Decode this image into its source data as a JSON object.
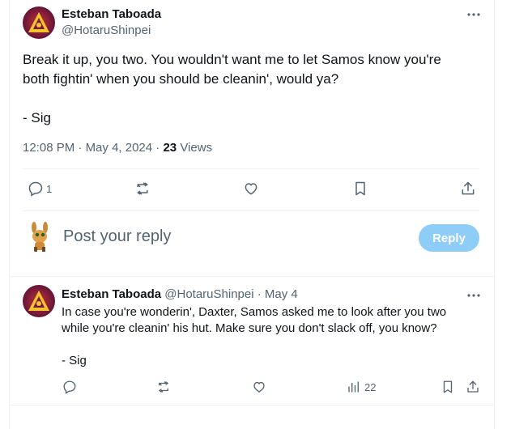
{
  "main_tweet": {
    "display_name": "Esteban Taboada",
    "handle": "@HotaruShinpei",
    "text": "Break it up, you two. You wouldn't want me to let Samos know you're\nboth fightin' when you should be cleanin', would ya?\n\n- Sig",
    "time": "12:08 PM",
    "date": "May 4, 2024",
    "views_count": "23",
    "views_label": "Views",
    "reply_count": "1",
    "more_icon": "more-icon"
  },
  "reply_box": {
    "placeholder": "Post your reply",
    "button_label": "Reply",
    "button_color": "#8ecdf8"
  },
  "reply_tweet": {
    "display_name": "Esteban Taboada",
    "handle": "@HotaruShinpei",
    "date": "May 4",
    "text": "In case you're wonderin', Daxter, Samos asked me to look after you two\nwhile you're cleanin' his hut. Make sure you don't slack off, you know?\n\n- Sig",
    "views_count": "22"
  },
  "colors": {
    "text_primary": "#0f1419",
    "text_secondary": "#536471",
    "divider": "#eff3f4"
  }
}
